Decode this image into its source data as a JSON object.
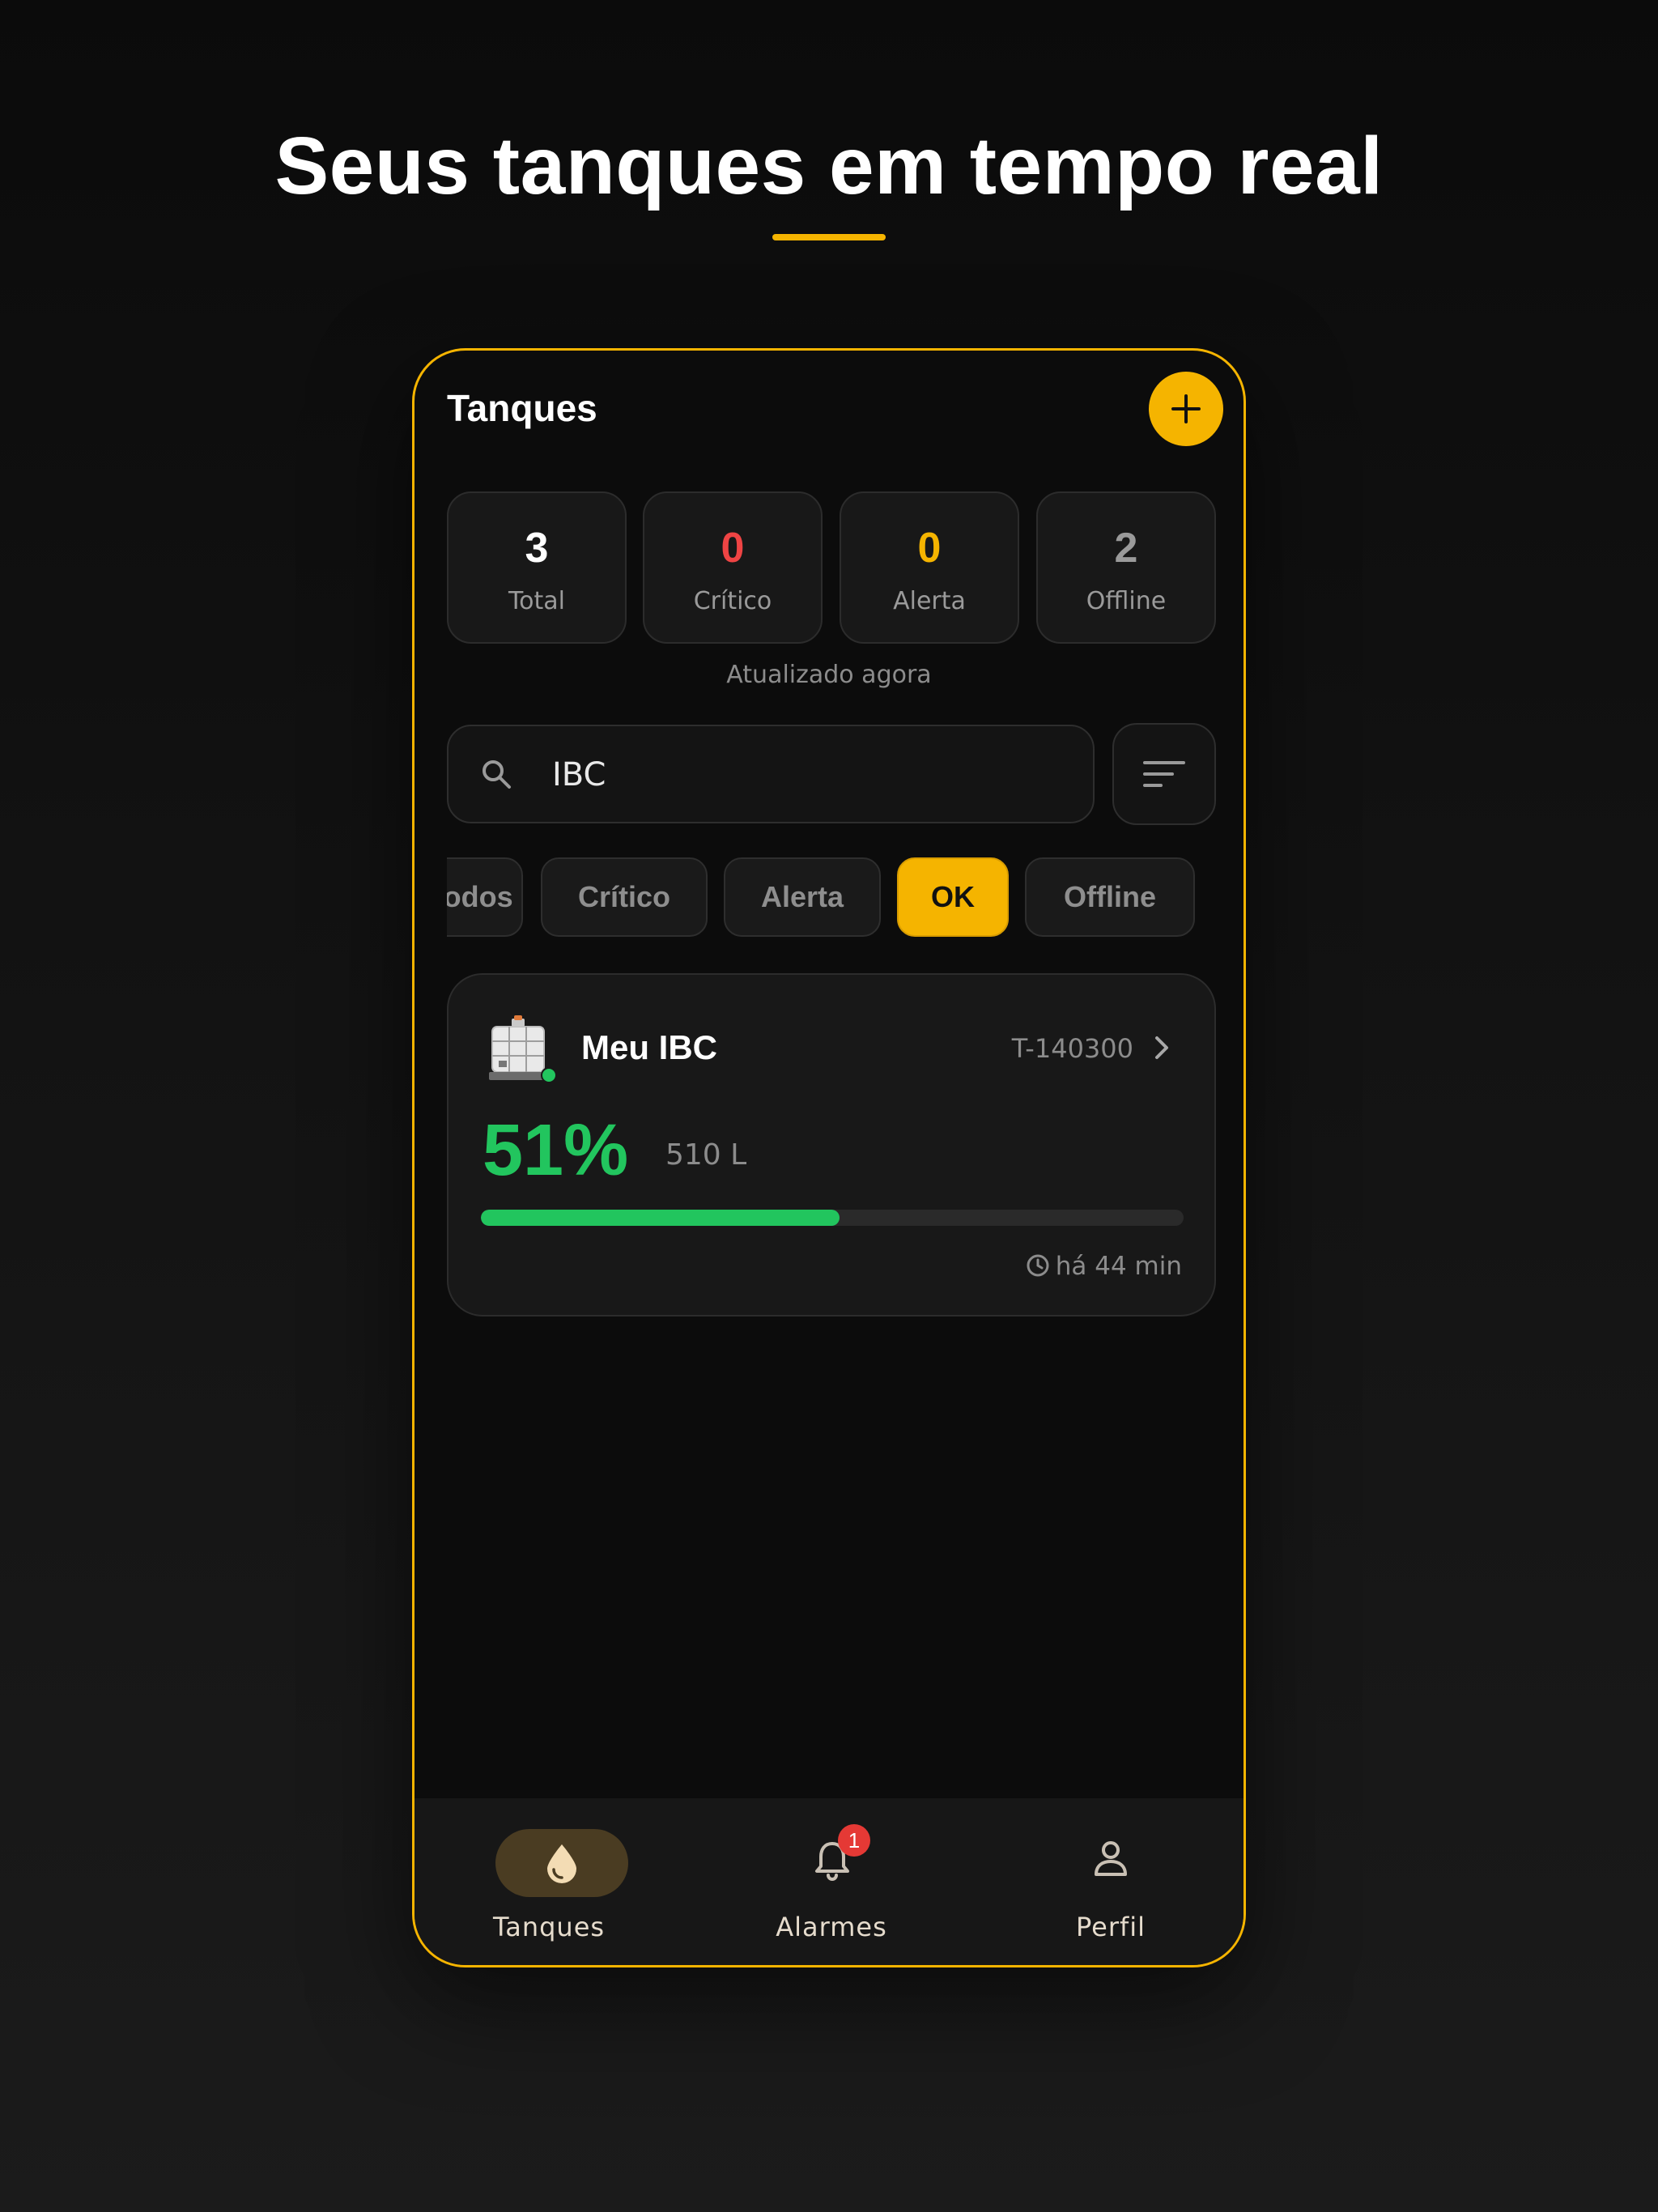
{
  "hero": {
    "title": "Seus tanques em tempo real"
  },
  "app": {
    "title": "Tanques"
  },
  "stats": [
    {
      "value": "3",
      "label": "Total",
      "color": "#ffffff"
    },
    {
      "value": "0",
      "label": "Crítico",
      "color": "#ef4444"
    },
    {
      "value": "0",
      "label": "Alerta",
      "color": "#f5b400"
    },
    {
      "value": "2",
      "label": "Offline",
      "color": "#9a9a9a"
    }
  ],
  "updated_text": "Atualizado agora",
  "search": {
    "value": "IBC"
  },
  "chips": [
    {
      "label": "Todos",
      "active": false
    },
    {
      "label": "Crítico",
      "active": false
    },
    {
      "label": "Alerta",
      "active": false
    },
    {
      "label": "OK",
      "active": true
    },
    {
      "label": "Offline",
      "active": false
    }
  ],
  "tank": {
    "name": "Meu IBC",
    "id": "T-140300",
    "percent_label": "51%",
    "level_fraction": 0.51,
    "liters": "510 L",
    "last_update": "há 44 min",
    "status": "online"
  },
  "nav": [
    {
      "label": "Tanques",
      "icon": "drop-icon",
      "active": true
    },
    {
      "label": "Alarmes",
      "icon": "bell-icon",
      "badge": "1"
    },
    {
      "label": "Perfil",
      "icon": "person-icon"
    }
  ],
  "colors": {
    "accent": "#f5b400",
    "ok": "#22c55e",
    "critical": "#ef4444"
  }
}
